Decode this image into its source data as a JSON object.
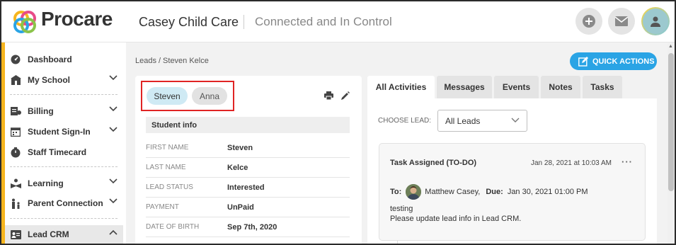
{
  "header": {
    "logo_text": "Procare",
    "org_name": "Casey Child Care",
    "tagline": "Connected and In Control",
    "icons": [
      "plus-icon",
      "mail-icon",
      "user-avatar-icon"
    ]
  },
  "sidebar": {
    "items": [
      {
        "label": "Dashboard",
        "icon": "dashboard-icon",
        "chevron": false
      },
      {
        "label": "My School",
        "icon": "school-icon",
        "chevron": true
      },
      {
        "label": "Billing",
        "icon": "billing-icon",
        "chevron": true
      },
      {
        "label": "Student Sign-In",
        "icon": "calendar-icon",
        "chevron": true
      },
      {
        "label": "Staff Timecard",
        "icon": "timecard-icon",
        "chevron": false
      },
      {
        "label": "Learning",
        "icon": "learning-icon",
        "chevron": true
      },
      {
        "label": "Parent Connection",
        "icon": "family-icon",
        "chevron": true
      },
      {
        "label": "Lead CRM",
        "icon": "lead-crm-icon",
        "chevron": true,
        "expanded": true
      }
    ]
  },
  "breadcrumb": {
    "root": "Leads",
    "separator": "/",
    "current": "Steven Kelce"
  },
  "quick_actions": {
    "label": "QUICK ACTIONS"
  },
  "lead_chips": [
    "Steven",
    "Anna"
  ],
  "student_info": {
    "title": "Student info",
    "rows": [
      {
        "label": "FIRST NAME",
        "value": "Steven"
      },
      {
        "label": "LAST NAME",
        "value": "Kelce"
      },
      {
        "label": "LEAD STATUS",
        "value": "Interested"
      },
      {
        "label": "PAYMENT",
        "value": "UnPaid"
      },
      {
        "label": "DATE OF BIRTH",
        "value": "Sep 7th, 2020"
      }
    ]
  },
  "tabs": [
    "All Activities",
    "Messages",
    "Events",
    "Notes",
    "Tasks"
  ],
  "choose_lead": {
    "label": "CHOOSE LEAD:",
    "selected": "All Leads"
  },
  "activity": {
    "title": "Task Assigned (TO-DO)",
    "date": "Jan 28, 2021 at 10:03 AM",
    "more": "···",
    "to_label": "To:",
    "to_name": "Matthew Casey,",
    "due_label": "Due:",
    "due_date": "Jan 30, 2021 01:00 PM",
    "body_line1": "testing",
    "body_line2": "Please update lead info in Lead CRM."
  },
  "colors": {
    "accent": "#2aa4e5",
    "sidebar_accent": "#f6b51e",
    "highlight": "#e02424",
    "chip_active": "#cfeaf4"
  }
}
